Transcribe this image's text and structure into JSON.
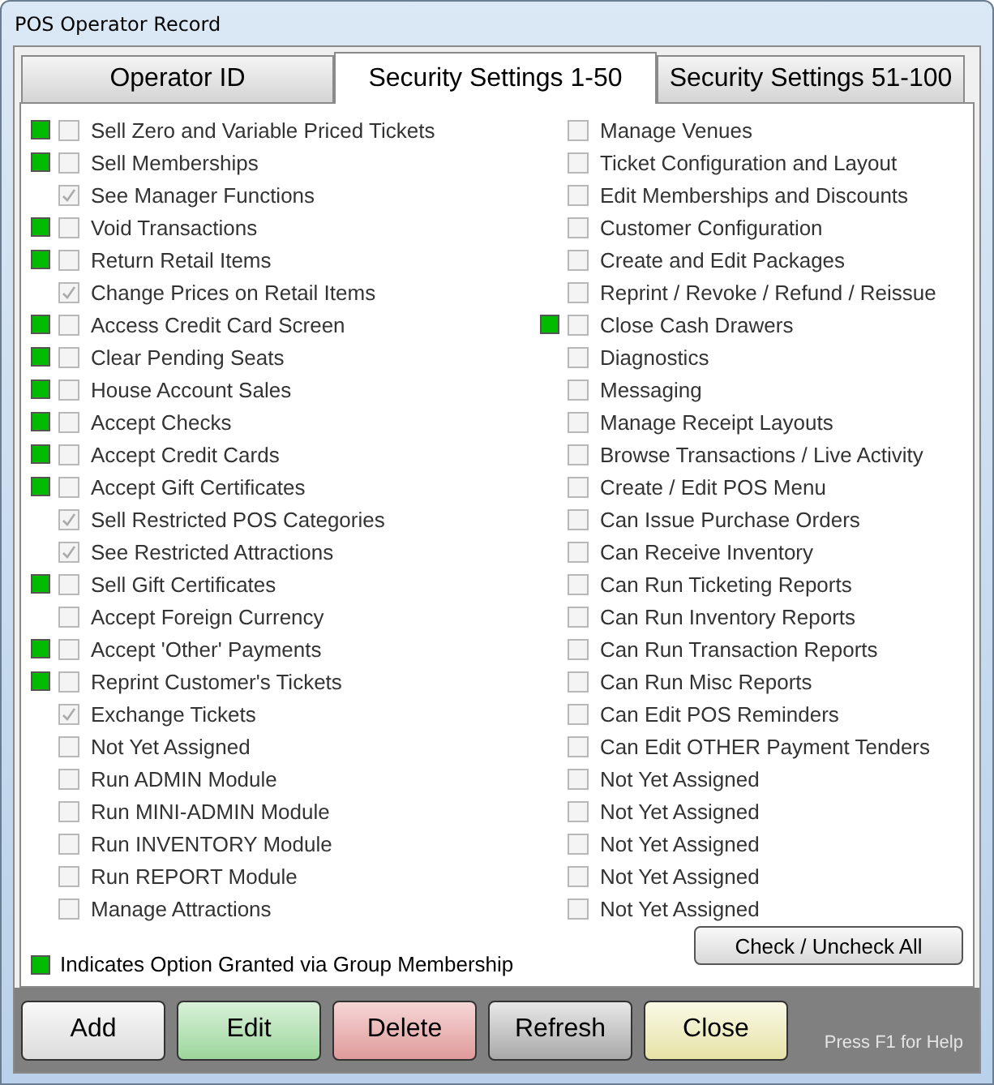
{
  "window": {
    "title": "POS Operator Record"
  },
  "tabs": [
    {
      "label": "Operator ID",
      "selected": false
    },
    {
      "label": "Security Settings 1-50",
      "selected": true
    },
    {
      "label": "Security Settings 51-100",
      "selected": false
    }
  ],
  "columns": [
    [
      {
        "label": "Sell Zero and Variable Priced Tickets",
        "granted": true,
        "checked": false
      },
      {
        "label": "Sell Memberships",
        "granted": true,
        "checked": false
      },
      {
        "label": "See Manager Functions",
        "granted": false,
        "checked": true
      },
      {
        "label": "Void Transactions",
        "granted": true,
        "checked": false
      },
      {
        "label": "Return Retail Items",
        "granted": true,
        "checked": false
      },
      {
        "label": "Change Prices on Retail Items",
        "granted": false,
        "checked": true
      },
      {
        "label": "Access Credit Card Screen",
        "granted": true,
        "checked": false
      },
      {
        "label": "Clear Pending Seats",
        "granted": true,
        "checked": false
      },
      {
        "label": "House Account Sales",
        "granted": true,
        "checked": false
      },
      {
        "label": "Accept Checks",
        "granted": true,
        "checked": false
      },
      {
        "label": "Accept Credit Cards",
        "granted": true,
        "checked": false
      },
      {
        "label": "Accept Gift Certificates",
        "granted": true,
        "checked": false
      },
      {
        "label": "Sell Restricted POS Categories",
        "granted": false,
        "checked": true
      },
      {
        "label": "See Restricted Attractions",
        "granted": false,
        "checked": true
      },
      {
        "label": "Sell Gift Certificates",
        "granted": true,
        "checked": false
      },
      {
        "label": "Accept Foreign Currency",
        "granted": false,
        "checked": false
      },
      {
        "label": "Accept 'Other' Payments",
        "granted": true,
        "checked": false
      },
      {
        "label": "Reprint Customer's Tickets",
        "granted": true,
        "checked": false
      },
      {
        "label": "Exchange Tickets",
        "granted": false,
        "checked": true
      },
      {
        "label": "Not Yet Assigned",
        "granted": false,
        "checked": false
      },
      {
        "label": "Run ADMIN Module",
        "granted": false,
        "checked": false
      },
      {
        "label": "Run MINI-ADMIN Module",
        "granted": false,
        "checked": false
      },
      {
        "label": "Run INVENTORY Module",
        "granted": false,
        "checked": false
      },
      {
        "label": "Run REPORT Module",
        "granted": false,
        "checked": false
      },
      {
        "label": "Manage Attractions",
        "granted": false,
        "checked": false
      }
    ],
    [
      {
        "label": "Manage Venues",
        "granted": false,
        "checked": false
      },
      {
        "label": "Ticket Configuration and Layout",
        "granted": false,
        "checked": false
      },
      {
        "label": "Edit Memberships and Discounts",
        "granted": false,
        "checked": false
      },
      {
        "label": "Customer Configuration",
        "granted": false,
        "checked": false
      },
      {
        "label": "Create and Edit Packages",
        "granted": false,
        "checked": false
      },
      {
        "label": "Reprint / Revoke / Refund / Reissue",
        "granted": false,
        "checked": false
      },
      {
        "label": "Close Cash Drawers",
        "granted": true,
        "checked": false
      },
      {
        "label": "Diagnostics",
        "granted": false,
        "checked": false
      },
      {
        "label": "Messaging",
        "granted": false,
        "checked": false
      },
      {
        "label": "Manage Receipt Layouts",
        "granted": false,
        "checked": false
      },
      {
        "label": "Browse Transactions / Live Activity",
        "granted": false,
        "checked": false
      },
      {
        "label": "Create / Edit POS Menu",
        "granted": false,
        "checked": false
      },
      {
        "label": "Can Issue Purchase Orders",
        "granted": false,
        "checked": false
      },
      {
        "label": "Can Receive Inventory",
        "granted": false,
        "checked": false
      },
      {
        "label": "Can Run Ticketing Reports",
        "granted": false,
        "checked": false
      },
      {
        "label": "Can Run Inventory Reports",
        "granted": false,
        "checked": false
      },
      {
        "label": "Can Run Transaction Reports",
        "granted": false,
        "checked": false
      },
      {
        "label": "Can Run Misc Reports",
        "granted": false,
        "checked": false
      },
      {
        "label": "Can Edit POS Reminders",
        "granted": false,
        "checked": false
      },
      {
        "label": "Can Edit OTHER Payment Tenders",
        "granted": false,
        "checked": false
      },
      {
        "label": "Not Yet Assigned",
        "granted": false,
        "checked": false
      },
      {
        "label": "Not Yet Assigned",
        "granted": false,
        "checked": false
      },
      {
        "label": "Not Yet Assigned",
        "granted": false,
        "checked": false
      },
      {
        "label": "Not Yet Assigned",
        "granted": false,
        "checked": false
      },
      {
        "label": "Not Yet Assigned",
        "granted": false,
        "checked": false
      }
    ]
  ],
  "legend": "Indicates Option Granted via Group Membership",
  "check_all_button": "Check / Uncheck All",
  "buttons": [
    {
      "label": "Add",
      "kind": "plain"
    },
    {
      "label": "Edit",
      "kind": "green"
    },
    {
      "label": "Delete",
      "kind": "red"
    },
    {
      "label": "Refresh",
      "kind": "grey"
    },
    {
      "label": "Close",
      "kind": "yellow"
    }
  ],
  "help_text": "Press F1 for Help"
}
